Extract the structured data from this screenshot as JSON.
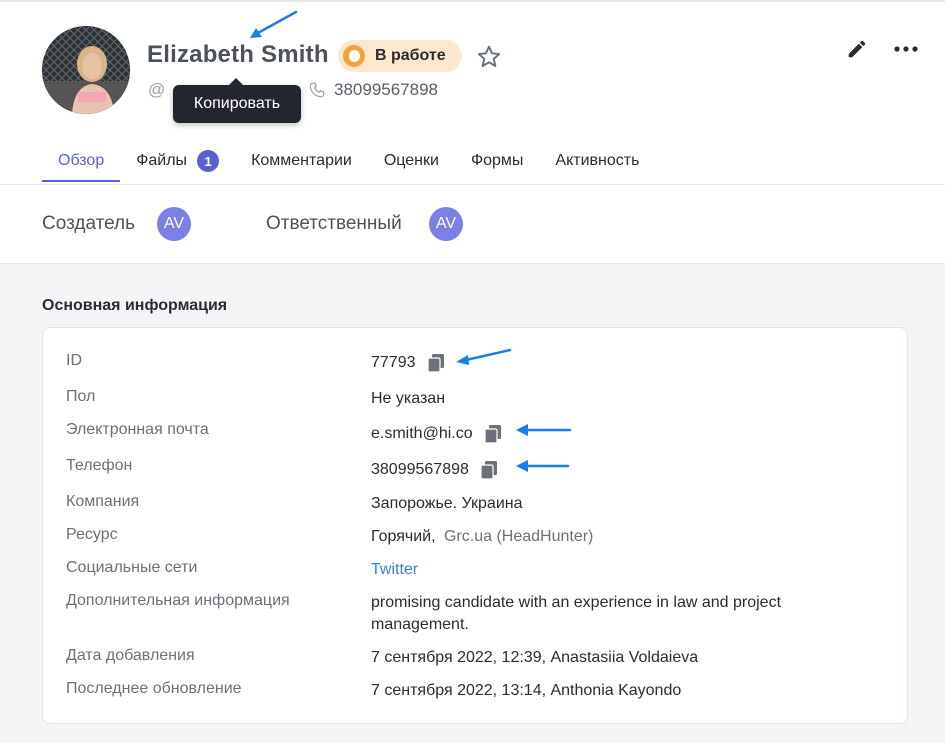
{
  "profile": {
    "name": "Elizabeth Smith",
    "status": "В работе",
    "email_prefix": "@",
    "phone": "38099567898",
    "tooltip": "Копировать"
  },
  "tabs": [
    {
      "label": "Обзор"
    },
    {
      "label": "Файлы",
      "badge": "1"
    },
    {
      "label": "Комментарии"
    },
    {
      "label": "Оценки"
    },
    {
      "label": "Формы"
    },
    {
      "label": "Активность"
    }
  ],
  "people": {
    "creator_label": "Создатель",
    "creator_initials": "AV",
    "responsible_label": "Ответственный",
    "responsible_initials": "AV"
  },
  "main_info": {
    "title": "Основная информация",
    "rows": [
      {
        "label": "ID",
        "value": "77793"
      },
      {
        "label": "Пол",
        "value": "Не указан"
      },
      {
        "label": "Электронная почта",
        "value": "e.smith@hi.co"
      },
      {
        "label": "Телефон",
        "value": "38099567898"
      },
      {
        "label": "Компания",
        "value": "Запорожье. Украина"
      },
      {
        "label": "Ресурс",
        "value": "Горячий,",
        "value2": "Grc.ua (HeadHunter)"
      },
      {
        "label": "Социальные сети",
        "value": "Twitter"
      },
      {
        "label": "Дополнительная информация",
        "value": "promising candidate with an experience in law and project management."
      },
      {
        "label": "Дата добавления",
        "value": "7 сентября 2022, 12:39, Anastasiia Voldaieva"
      },
      {
        "label": "Последнее обновление",
        "value": "7 сентября 2022, 13:14, Anthonia Kayondo"
      }
    ]
  },
  "colors": {
    "accent": "#5b5fd6",
    "status_bg": "#fde7cf",
    "status_dot": "#f4a53a",
    "link": "#3b7dd8",
    "annotation_arrow": "#1a7fe8"
  }
}
